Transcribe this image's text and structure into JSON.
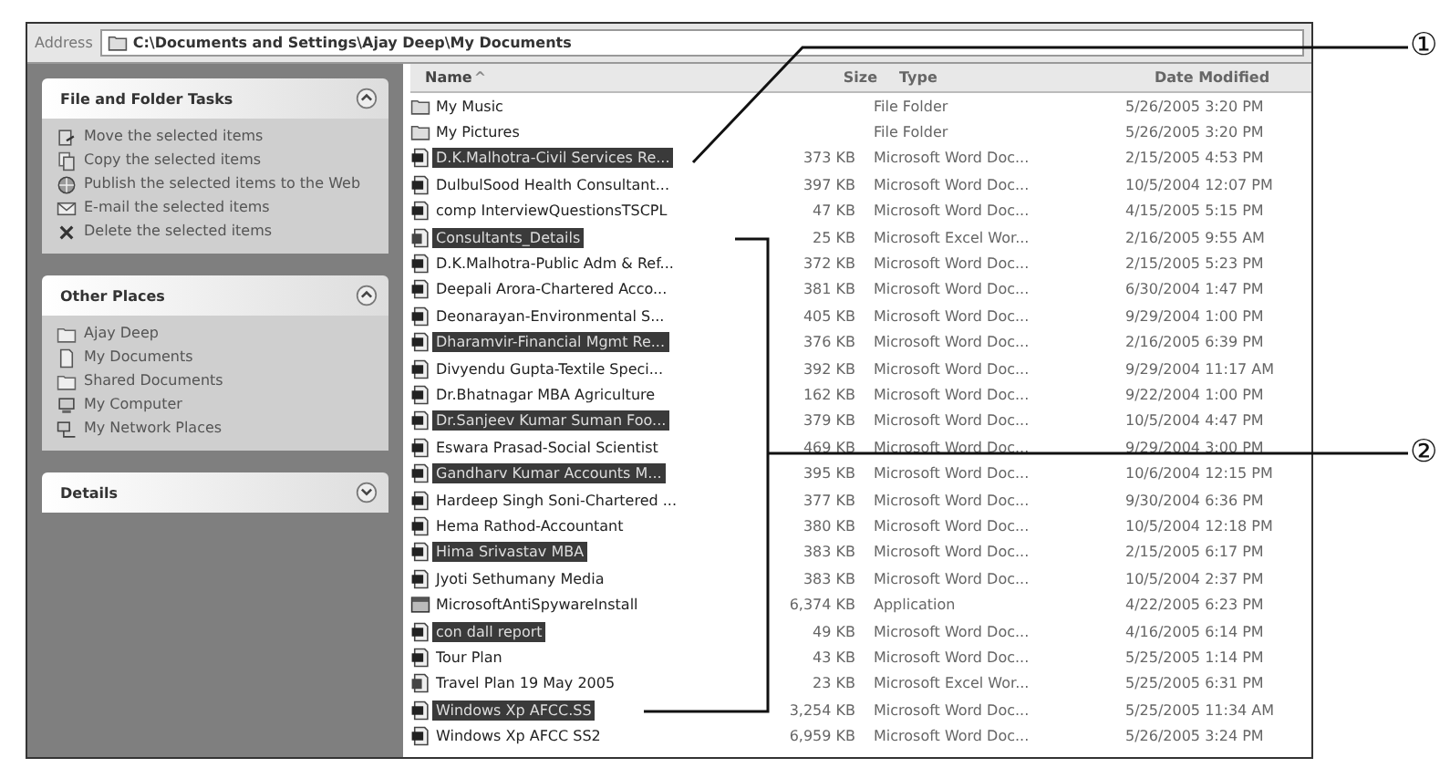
{
  "address_bar": {
    "label": "Address",
    "path": "C:\\Documents and Settings\\Ajay Deep\\My Documents"
  },
  "task_panes": [
    {
      "title": "File and Folder Tasks",
      "expanded": true,
      "items": [
        {
          "label": "Move the selected items",
          "kind": "move"
        },
        {
          "label": "Copy the selected items",
          "kind": "copy"
        },
        {
          "label": "Publish the selected items to the Web",
          "kind": "web"
        },
        {
          "label": "E-mail the selected items",
          "kind": "mail"
        },
        {
          "label": "Delete the selected items",
          "kind": "delete"
        }
      ]
    },
    {
      "title": "Other Places",
      "expanded": true,
      "items": [
        {
          "label": "Ajay Deep",
          "kind": "folder"
        },
        {
          "label": "My Documents",
          "kind": "docs"
        },
        {
          "label": "Shared Documents",
          "kind": "folder"
        },
        {
          "label": "My Computer",
          "kind": "computer"
        },
        {
          "label": "My Network Places",
          "kind": "network"
        }
      ]
    },
    {
      "title": "Details",
      "expanded": false
    }
  ],
  "file_list": {
    "columns": [
      "Name",
      "Size",
      "Type",
      "Date Modified"
    ],
    "sort_indicator": "^",
    "rows": [
      {
        "name": "My Music",
        "size": "",
        "type": "File Folder",
        "date": "5/26/2005 3:20 PM",
        "kind": "folder",
        "selected": false
      },
      {
        "name": "My Pictures",
        "size": "",
        "type": "File Folder",
        "date": "5/26/2005 3:20 PM",
        "kind": "folder",
        "selected": false
      },
      {
        "name": "D.K.Malhotra-Civil Services Re...",
        "size": "373 KB",
        "type": "Microsoft Word Doc...",
        "date": "2/15/2005 4:53 PM",
        "kind": "word",
        "selected": true
      },
      {
        "name": "DulbulSood Health Consultant...",
        "size": "397 KB",
        "type": "Microsoft Word Doc...",
        "date": "10/5/2004 12:07 PM",
        "kind": "word",
        "selected": false
      },
      {
        "name": "comp InterviewQuestionsTSCPL",
        "size": "47 KB",
        "type": "Microsoft Word Doc...",
        "date": "4/15/2005 5:15 PM",
        "kind": "word",
        "selected": false
      },
      {
        "name": "Consultants_Details",
        "size": "25 KB",
        "type": "Microsoft Excel Wor...",
        "date": "2/16/2005 9:55 AM",
        "kind": "excel",
        "selected": true
      },
      {
        "name": "D.K.Malhotra-Public Adm & Ref...",
        "size": "372 KB",
        "type": "Microsoft Word Doc...",
        "date": "2/15/2005 5:23 PM",
        "kind": "word",
        "selected": false
      },
      {
        "name": "Deepali Arora-Chartered Acco...",
        "size": "381 KB",
        "type": "Microsoft Word Doc...",
        "date": "6/30/2004 1:47 PM",
        "kind": "word",
        "selected": false
      },
      {
        "name": "Deonarayan-Environmental S...",
        "size": "405 KB",
        "type": "Microsoft Word Doc...",
        "date": "9/29/2004 1:00 PM",
        "kind": "word",
        "selected": false
      },
      {
        "name": "Dharamvir-Financial Mgmt Re...",
        "size": "376 KB",
        "type": "Microsoft Word Doc...",
        "date": "2/16/2005 6:39 PM",
        "kind": "word",
        "selected": true
      },
      {
        "name": "Divyendu Gupta-Textile Speci...",
        "size": "392 KB",
        "type": "Microsoft Word Doc...",
        "date": "9/29/2004 11:17 AM",
        "kind": "word",
        "selected": false
      },
      {
        "name": "Dr.Bhatnagar MBA Agriculture",
        "size": "162 KB",
        "type": "Microsoft Word Doc...",
        "date": "9/22/2004 1:00 PM",
        "kind": "word",
        "selected": false
      },
      {
        "name": "Dr.Sanjeev Kumar Suman Foo...",
        "size": "379 KB",
        "type": "Microsoft Word Doc...",
        "date": "10/5/2004 4:47 PM",
        "kind": "word",
        "selected": true
      },
      {
        "name": "Eswara Prasad-Social Scientist",
        "size": "469 KB",
        "type": "Microsoft Word Doc...",
        "date": "9/29/2004 3:00 PM",
        "kind": "word",
        "selected": false
      },
      {
        "name": "Gandharv Kumar Accounts M...",
        "size": "395 KB",
        "type": "Microsoft Word Doc...",
        "date": "10/6/2004 12:15 PM",
        "kind": "word",
        "selected": true
      },
      {
        "name": "Hardeep Singh Soni-Chartered ...",
        "size": "377 KB",
        "type": "Microsoft Word Doc...",
        "date": "9/30/2004 6:36 PM",
        "kind": "word",
        "selected": false
      },
      {
        "name": "Hema Rathod-Accountant",
        "size": "380 KB",
        "type": "Microsoft Word Doc...",
        "date": "10/5/2004 12:18 PM",
        "kind": "word",
        "selected": false
      },
      {
        "name": "Hima Srivastav MBA",
        "size": "383 KB",
        "type": "Microsoft Word Doc...",
        "date": "2/15/2005 6:17 PM",
        "kind": "word",
        "selected": true
      },
      {
        "name": "Jyoti Sethumany Media",
        "size": "383 KB",
        "type": "Microsoft Word Doc...",
        "date": "10/5/2004 2:37 PM",
        "kind": "word",
        "selected": false
      },
      {
        "name": "MicrosoftAntiSpywareInstall",
        "size": "6,374 KB",
        "type": "Application",
        "date": "4/22/2005 6:23 PM",
        "kind": "app",
        "selected": false
      },
      {
        "name": "con dall report",
        "size": "49 KB",
        "type": "Microsoft Word Doc...",
        "date": "4/16/2005 6:14 PM",
        "kind": "word",
        "selected": true
      },
      {
        "name": "Tour Plan",
        "size": "43 KB",
        "type": "Microsoft Word Doc...",
        "date": "5/25/2005 1:14 PM",
        "kind": "word",
        "selected": false
      },
      {
        "name": "Travel Plan 19 May 2005",
        "size": "23 KB",
        "type": "Microsoft Excel Wor...",
        "date": "5/25/2005 6:31 PM",
        "kind": "excel",
        "selected": false
      },
      {
        "name": "Windows Xp AFCC.SS",
        "size": "3,254 KB",
        "type": "Microsoft Word Doc...",
        "date": "5/25/2005 11:34 AM",
        "kind": "word",
        "selected": true
      },
      {
        "name": "Windows Xp AFCC SS2",
        "size": "6,959 KB",
        "type": "Microsoft Word Doc...",
        "date": "5/26/2005 3:24 PM",
        "kind": "word",
        "selected": false
      }
    ]
  },
  "callouts": [
    {
      "label": "①"
    },
    {
      "label": "②"
    }
  ]
}
